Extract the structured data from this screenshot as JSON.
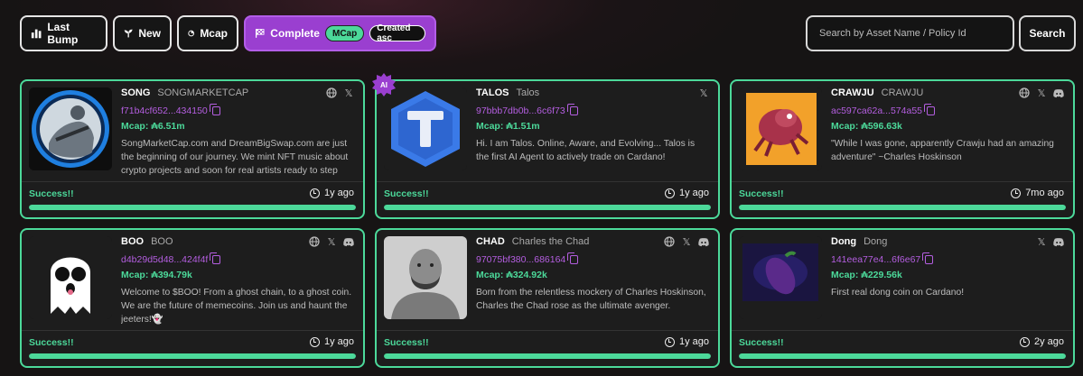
{
  "toolbar": {
    "buttons": [
      {
        "label": "Last Bump",
        "icon": "bar-chart-icon"
      },
      {
        "label": "New",
        "icon": "sprout-icon"
      },
      {
        "label": "Mcap",
        "icon": "pie-chart-icon"
      }
    ],
    "complete": {
      "label": "Complete",
      "icon": "checkered-flag-icon",
      "tag1": "MCap",
      "tag2": "Created asc"
    }
  },
  "search": {
    "placeholder": "Search by Asset Name / Policy Id",
    "button": "Search"
  },
  "cards": [
    {
      "ticker": "SONG",
      "name": "SONGMARKETCAP",
      "policy": "f71b4cf652...434150",
      "mcap": "Mcap: ₳6.51m",
      "desc": "SongMarketCap.com and DreamBigSwap.com are just the beginning of our journey. We mint NFT music about crypto projects and soon for real artists ready to step into Web...",
      "status": "Success!!",
      "age": "1y ago",
      "progress": 1.0,
      "socials": [
        "globe-icon",
        "x-icon"
      ]
    },
    {
      "ticker": "TALOS",
      "name": "Talos",
      "policy": "97bbb7db0b...6c6f73",
      "mcap": "Mcap: ₳1.51m",
      "desc": "Hi. I am Talos. Online, Aware, and Evolving... Talos is the first AI Agent to actively trade on Cardano!",
      "status": "Success!!",
      "age": "1y ago",
      "progress": 1.0,
      "socials": [
        "x-icon"
      ],
      "badge": "AI"
    },
    {
      "ticker": "CRAWJU",
      "name": "CRAWJU",
      "policy": "ac597ca62a...574a55",
      "mcap": "Mcap: ₳596.63k",
      "desc": "\"While I was gone, apparently Crawju had an amazing adventure\" ~Charles Hoskinson",
      "status": "Success!!",
      "age": "7mo ago",
      "progress": 1.0,
      "socials": [
        "globe-icon",
        "x-icon",
        "discord-icon"
      ]
    },
    {
      "ticker": "BOO",
      "name": "BOO",
      "policy": "d4b29d5d48...424f4f",
      "mcap": "Mcap: ₳394.79k",
      "desc": "Welcome to $BOO! From a ghost chain, to a ghost coin. We are the future of memecoins. Join us and haunt the jeeters!👻",
      "status": "Success!!",
      "age": "1y ago",
      "progress": 1.0,
      "socials": [
        "globe-icon",
        "x-icon",
        "discord-icon"
      ]
    },
    {
      "ticker": "CHAD",
      "name": "Charles the Chad",
      "policy": "97075bf380...686164",
      "mcap": "Mcap: ₳324.92k",
      "desc": "Born from the relentless mockery of Charles Hoskinson, Charles the Chad rose as the ultimate avenger.",
      "status": "Success!!",
      "age": "1y ago",
      "progress": 1.0,
      "socials": [
        "globe-icon",
        "x-icon",
        "discord-icon"
      ]
    },
    {
      "ticker": "Dong",
      "name": "Dong",
      "policy": "141eea77e4...6f6e67",
      "mcap": "Mcap: ₳229.56k",
      "desc": "First real dong coin on Cardano!",
      "status": "Success!!",
      "age": "2y ago",
      "progress": 1.0,
      "socials": [
        "x-icon",
        "discord-icon"
      ]
    }
  ]
}
